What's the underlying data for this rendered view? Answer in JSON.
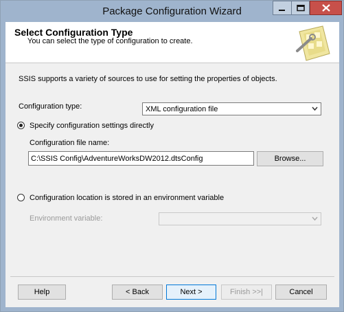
{
  "window": {
    "title": "Package Configuration Wizard",
    "controls": {
      "minimize": "minimize-icon",
      "maximize": "maximize-icon",
      "close": "close-icon"
    }
  },
  "header": {
    "title": "Select Configuration Type",
    "subtitle": "You can select the type of configuration to create."
  },
  "body": {
    "description": "SSIS supports a variety of sources to use for setting the properties of objects.",
    "config_type_label": "Configuration type:",
    "config_type_value": "XML configuration file",
    "option_direct": "Specify configuration settings directly",
    "file_name_label": "Configuration file name:",
    "file_name_value": "C:\\SSIS Config\\AdventureWorksDW2012.dtsConfig",
    "browse_label": "Browse...",
    "option_env": "Configuration location is stored in an environment variable",
    "env_var_label": "Environment variable:",
    "env_var_value": ""
  },
  "footer": {
    "help": "Help",
    "back": "< Back",
    "next": "Next >",
    "finish": "Finish >>|",
    "cancel": "Cancel"
  },
  "colors": {
    "titlebar": "#9fb4cd",
    "close": "#c7504a",
    "focus": "#0078d7"
  }
}
